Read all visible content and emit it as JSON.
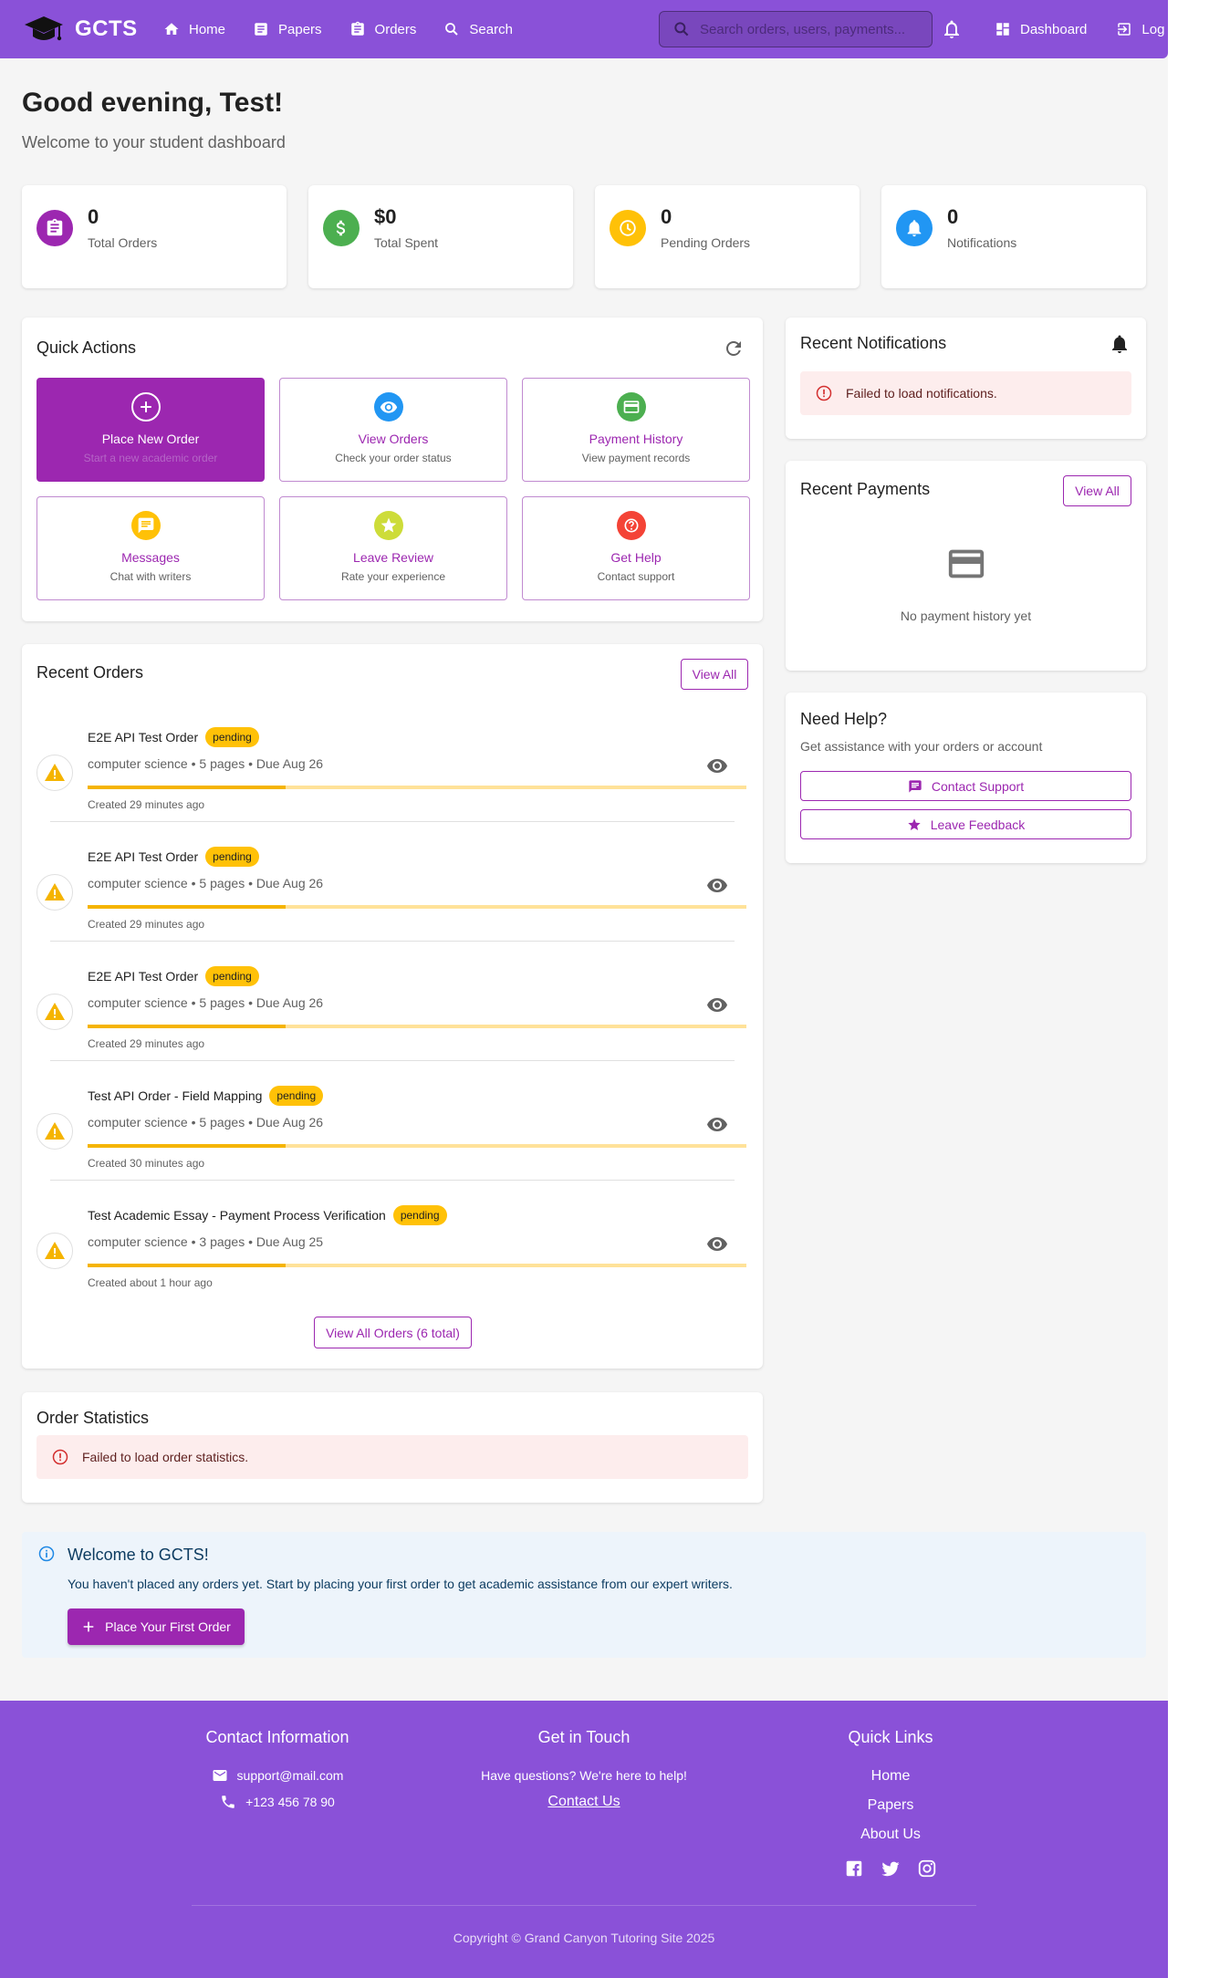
{
  "nav": {
    "brand": "GCTS",
    "links": [
      "Home",
      "Papers",
      "Orders",
      "Search"
    ],
    "search_placeholder": "Search orders, users, payments...",
    "dashboard": "Dashboard",
    "logout": "Log"
  },
  "greeting": {
    "title": "Good evening, Test!",
    "subtitle": "Welcome to your student dashboard"
  },
  "stats": [
    {
      "value": "0",
      "label": "Total Orders",
      "color": "#9c27b0",
      "icon": "clipboard-icon"
    },
    {
      "value": "$0",
      "label": "Total Spent",
      "color": "#4caf50",
      "icon": "dollar-icon"
    },
    {
      "value": "0",
      "label": "Pending Orders",
      "color": "#ffc107",
      "icon": "clock-icon"
    },
    {
      "value": "0",
      "label": "Notifications",
      "color": "#2196f3",
      "icon": "bell-icon"
    }
  ],
  "quick_actions": {
    "title": "Quick Actions",
    "items": [
      {
        "title": "Place New Order",
        "subtitle": "Start a new academic order",
        "icon": "plus-icon",
        "color": "#9c27b0"
      },
      {
        "title": "View Orders",
        "subtitle": "Check your order status",
        "icon": "eye-icon",
        "color": "#2196f3"
      },
      {
        "title": "Payment History",
        "subtitle": "View payment records",
        "icon": "card-icon",
        "color": "#4caf50"
      },
      {
        "title": "Messages",
        "subtitle": "Chat with writers",
        "icon": "message-icon",
        "color": "#ffc107"
      },
      {
        "title": "Leave Review",
        "subtitle": "Rate your experience",
        "icon": "star-icon",
        "color": "#cddc39"
      },
      {
        "title": "Get Help",
        "subtitle": "Contact support",
        "icon": "help-icon",
        "color": "#f44336"
      }
    ]
  },
  "recent_orders": {
    "title": "Recent Orders",
    "view_all": "View All",
    "items": [
      {
        "title": "E2E API Test Order",
        "status": "pending",
        "meta": "computer science • 5 pages • Due Aug 26",
        "created": "Created 29 minutes ago",
        "progress": 0.3
      },
      {
        "title": "E2E API Test Order",
        "status": "pending",
        "meta": "computer science • 5 pages • Due Aug 26",
        "created": "Created 29 minutes ago",
        "progress": 0.3
      },
      {
        "title": "E2E API Test Order",
        "status": "pending",
        "meta": "computer science • 5 pages • Due Aug 26",
        "created": "Created 29 minutes ago",
        "progress": 0.3
      },
      {
        "title": "Test API Order - Field Mapping",
        "status": "pending",
        "meta": "computer science • 5 pages • Due Aug 26",
        "created": "Created 30 minutes ago",
        "progress": 0.3
      },
      {
        "title": "Test Academic Essay - Payment Process Verification",
        "status": "pending",
        "meta": "computer science • 3 pages • Due Aug 25",
        "created": "Created about 1 hour ago",
        "progress": 0.3
      }
    ],
    "view_all_total": "View All Orders (6 total)"
  },
  "order_statistics": {
    "title": "Order Statistics",
    "error": "Failed to load order statistics."
  },
  "notifications": {
    "title": "Recent Notifications",
    "error": "Failed to load notifications."
  },
  "payments": {
    "title": "Recent Payments",
    "view_all": "View All",
    "empty": "No payment history yet"
  },
  "help": {
    "title": "Need Help?",
    "subtitle": "Get assistance with your orders or account",
    "contact": "Contact Support",
    "feedback": "Leave Feedback"
  },
  "welcome": {
    "title": "Welcome to GCTS!",
    "text": "You haven't placed any orders yet. Start by placing your first order to get academic assistance from our expert writers.",
    "button": "Place Your First Order"
  },
  "footer": {
    "contact_title": "Contact Information",
    "email": "support@mail.com",
    "phone": "+123 456 78 90",
    "touch_title": "Get in Touch",
    "touch_text": "Have questions? We're here to help!",
    "contact_link": "Contact Us",
    "links_title": "Quick Links",
    "links": [
      "Home",
      "Papers",
      "About Us"
    ],
    "copyright": "Copyright © Grand Canyon Tutoring Site 2025"
  },
  "colors": {
    "nav": "#8a51d8",
    "accent": "#9c27b0",
    "pending": "#ffc107"
  }
}
